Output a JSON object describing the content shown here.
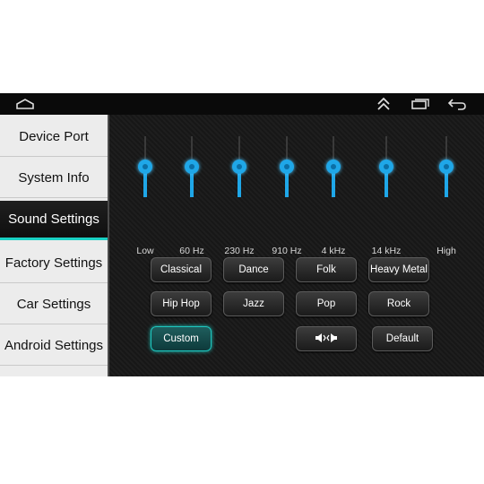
{
  "sidebar": {
    "items": [
      {
        "label": "Device Port"
      },
      {
        "label": "System Info"
      },
      {
        "label": "Sound Settings",
        "active": true
      },
      {
        "label": "Factory Settings"
      },
      {
        "label": "Car Settings"
      },
      {
        "label": "Android Settings"
      }
    ]
  },
  "topbar": {
    "icons": [
      "home-icon",
      "double-chevron-up-icon",
      "recent-apps-icon",
      "back-icon"
    ]
  },
  "equalizer": {
    "bands": [
      {
        "label": "Low",
        "level": 0.5
      },
      {
        "label": "60 Hz",
        "level": 0.5
      },
      {
        "label": "230 Hz",
        "level": 0.5
      },
      {
        "label": "910 Hz",
        "level": 0.5
      },
      {
        "label": "4 kHz",
        "level": 0.5
      },
      {
        "label": "14 kHz",
        "level": 0.5
      },
      {
        "label": "High",
        "level": 0.5
      }
    ],
    "accent_color": "#1fa7e8"
  },
  "presets": {
    "classical": "Classical",
    "dance": "Dance",
    "folk": "Folk",
    "heavy_metal": "Heavy Metal",
    "hip_hop": "Hip Hop",
    "jazz": "Jazz",
    "pop": "Pop",
    "rock": "Rock",
    "custom": "Custom",
    "default": "Default",
    "selected": "Custom",
    "balance_icon": "speaker-balance-icon"
  },
  "colors": {
    "selected_accent": "#1ec8c0"
  }
}
